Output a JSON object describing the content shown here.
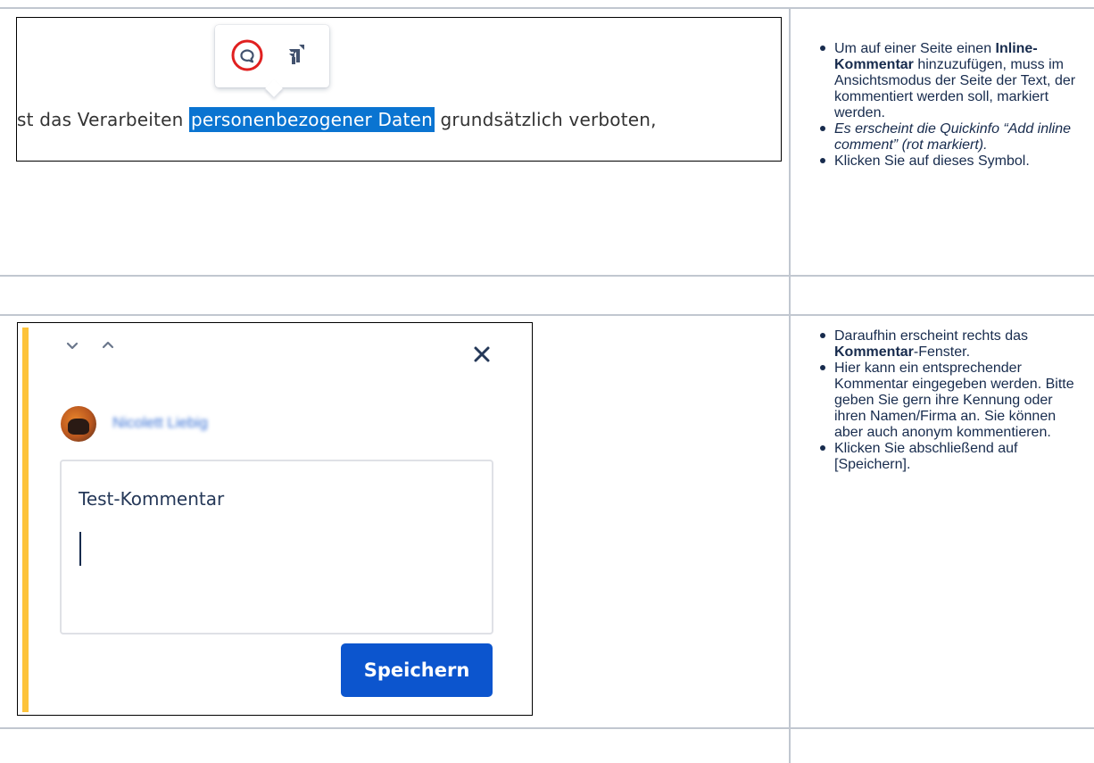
{
  "screenshot1": {
    "tooltip": {
      "comment_icon": "speech-bubble-icon",
      "jira_icon": "jira-icon",
      "highlight_color": "#e02020"
    },
    "sentence": {
      "before": "st das Verarbeiten ",
      "selected": "personenbezogener Daten",
      "after": " grundsätzlich verboten,"
    },
    "selection_color": "#0a74d1"
  },
  "step1": {
    "items": [
      {
        "pre": "Um auf einer Seite einen ",
        "bold": "Inline-Kommentar",
        "post": " hinzuzufügen, muss im Ansichtsmodus der Seite der Text, der kommentiert werden soll, markiert werden."
      },
      {
        "italic": "Es erscheint die Quickinfo “Add inline comment” (rot markiert)."
      },
      {
        "plain": "Klicken Sie auf dieses Symbol."
      }
    ]
  },
  "screenshot2": {
    "user_name": "Nicolett Liebig",
    "comment_value": "Test-Kommentar",
    "save_label": "Speichern",
    "accent_color": "#fdc33a",
    "button_color": "#0c55ce"
  },
  "step2": {
    "items": [
      {
        "pre": "Daraufhin erscheint rechts das ",
        "bold": "Kommentar",
        "post": "-Fenster."
      },
      {
        "plain": "Hier kann ein entsprechender Kommentar eingegeben werden. Bitte geben Sie gern ihre Kennung oder ihren Namen/Firma an. Sie können aber auch anonym kommentieren."
      },
      {
        "plain": "Klicken Sie abschließend auf [Speichern]."
      }
    ]
  }
}
